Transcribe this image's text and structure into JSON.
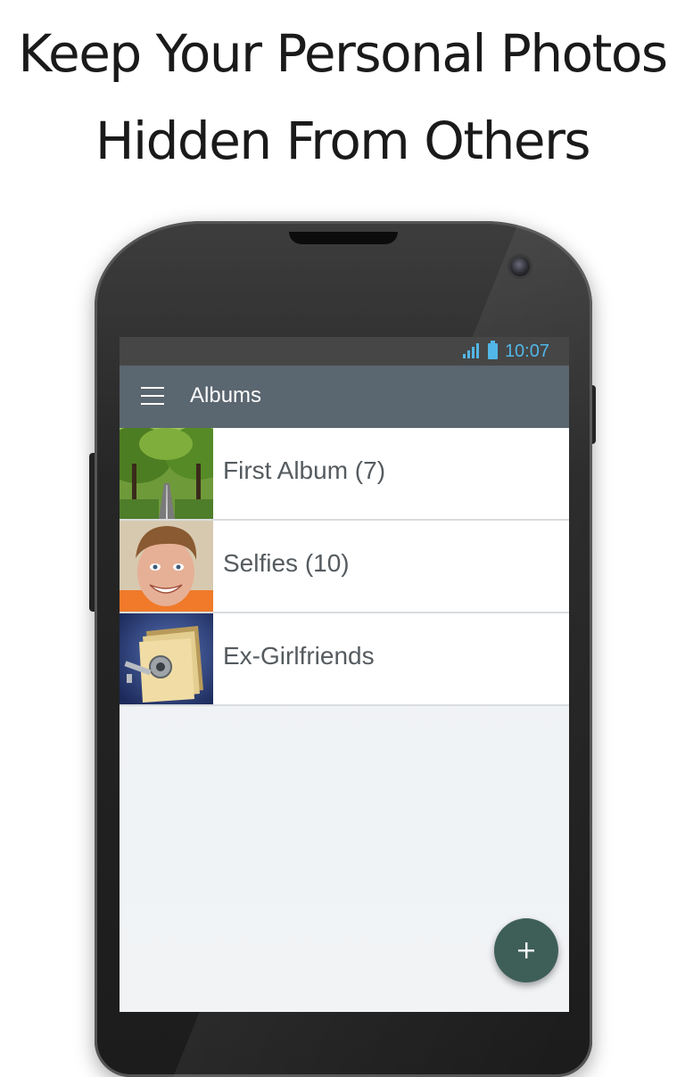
{
  "promo": {
    "headline_line1": "Keep Your Personal Photos",
    "headline_line2": "Hidden From Others"
  },
  "statusbar": {
    "time": "10:07",
    "icons": [
      "signal-icon",
      "battery-icon"
    ],
    "color": "#52b6e6"
  },
  "appbar": {
    "title": "Albums",
    "menu_icon": "menu-icon",
    "color": "#5a6670"
  },
  "albums": [
    {
      "label": "First Album (7)",
      "thumbnail": "tree-lined-road-photo"
    },
    {
      "label": "Selfies (10)",
      "thumbnail": "smiling-face-photo"
    },
    {
      "label": "Ex-Girlfriends",
      "thumbnail": "locked-folder-icon"
    }
  ],
  "fab": {
    "icon": "plus-icon",
    "glyph": "+",
    "color": "#3e5f57"
  }
}
